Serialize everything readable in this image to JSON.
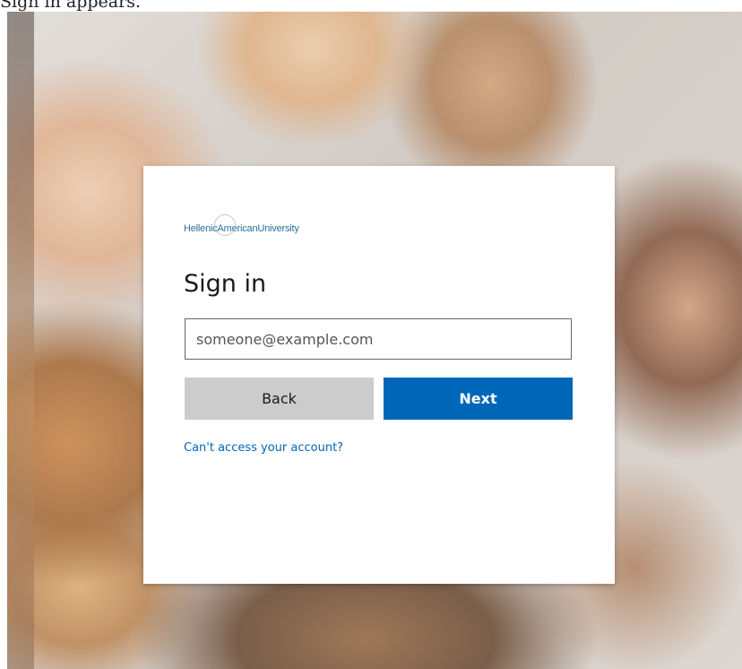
{
  "page": {
    "caption": "Sign in appears."
  },
  "signin": {
    "logo_text": "HellenicAmericanUniversity",
    "title": "Sign in",
    "email_placeholder": "someone@example.com",
    "back_label": "Back",
    "next_label": "Next",
    "cant_access_label": "Can't access your account?"
  },
  "colors": {
    "accent": "#0067b8",
    "back_button": "#cccccc",
    "logo": "#2a6f9a"
  }
}
